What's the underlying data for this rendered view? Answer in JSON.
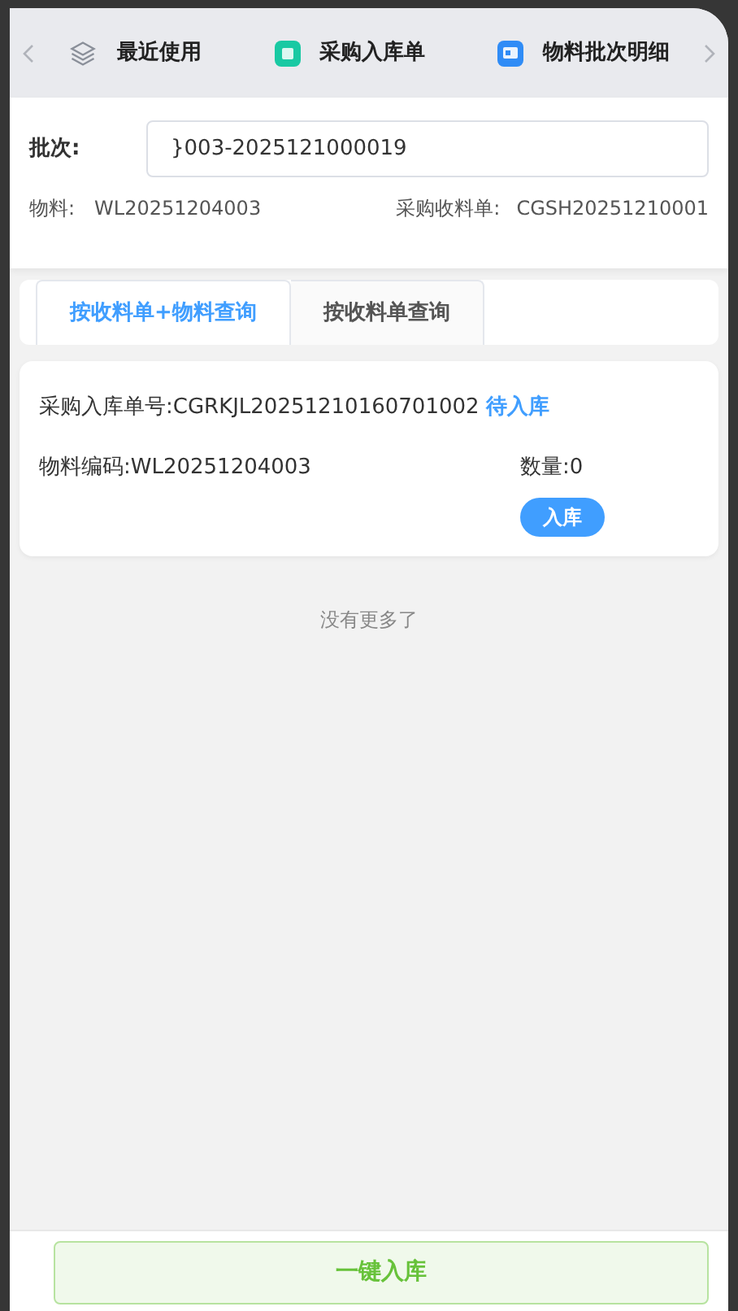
{
  "nav_tabs": [
    {
      "label": "最近使用",
      "kind": "layers"
    },
    {
      "label": "采购入库单",
      "kind": "green"
    },
    {
      "label": "物料批次明细",
      "kind": "blue"
    }
  ],
  "filter": {
    "batch_label": "批次:",
    "batch_value": "}003-2025121000019",
    "material_label": "物料:",
    "material_value": "WL20251204003",
    "receipt_label": "采购收料单:",
    "receipt_value": "CGSH20251210001"
  },
  "query_tabs": [
    {
      "label": "按收料单+物料查询",
      "selected": true
    },
    {
      "label": "按收料单查询",
      "selected": false
    }
  ],
  "records": [
    {
      "order": "采购入库单号:CGRKJL20251210160701002",
      "status": "待入库",
      "material": "物料编码:WL20251204003",
      "quantity": "数量:0",
      "action": "入库"
    }
  ],
  "no_more": "没有更多了",
  "bottom_button": "一键入库"
}
